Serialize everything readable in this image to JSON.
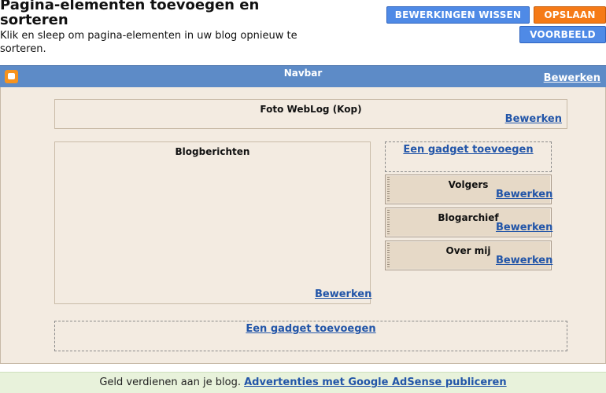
{
  "header": {
    "title": "Pagina-elementen toevoegen en sorteren",
    "subtitle": "Klik en sleep om pagina-elementen in uw blog opnieuw te sorteren."
  },
  "buttons": {
    "clear": "BEWERKINGEN WISSEN",
    "save": "OPSLAAN",
    "preview": "VOORBEELD"
  },
  "navbar": {
    "title": "Navbar",
    "edit": "Bewerken"
  },
  "header_gadget": {
    "title": "Foto WebLog (Kop)",
    "edit": "Bewerken"
  },
  "blog_posts": {
    "title": "Blogberichten",
    "edit": "Bewerken"
  },
  "sidebar": {
    "add_gadget": "Een gadget toevoegen",
    "widgets": [
      {
        "title": "Volgers",
        "edit": "Bewerken"
      },
      {
        "title": "Blogarchief",
        "edit": "Bewerken"
      },
      {
        "title": "Over mij",
        "edit": "Bewerken"
      }
    ]
  },
  "footer_add_gadget": "Een gadget toevoegen",
  "footer": {
    "text": "Geld verdienen aan je blog.",
    "link": "Advertenties met Google AdSense publiceren"
  },
  "colors": {
    "navbar": "#5d8bc7",
    "layout_bg": "#f3ebe1",
    "save": "#f57a17",
    "button_blue": "#4f8ae6"
  }
}
